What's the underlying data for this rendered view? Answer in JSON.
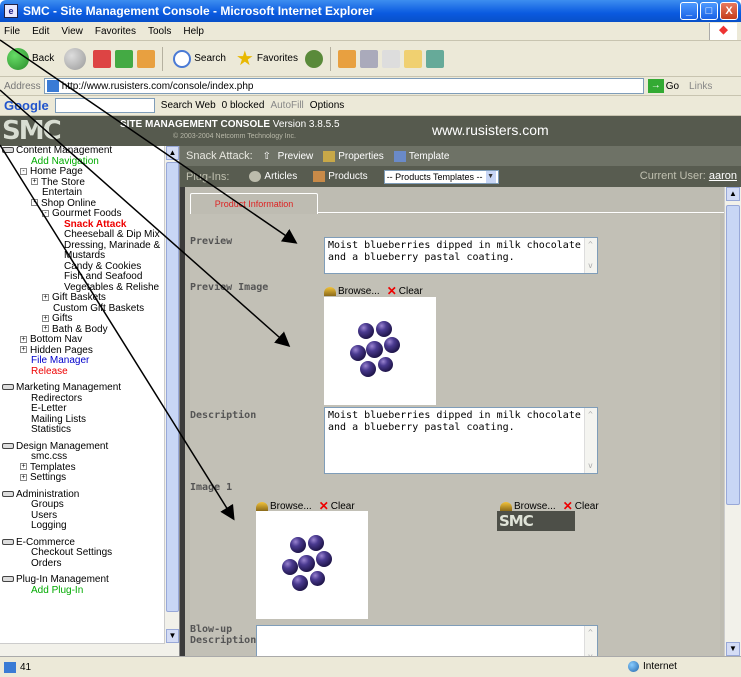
{
  "window": {
    "title": "SMC - Site Management Console - Microsoft Internet Explorer",
    "buttons": [
      "_",
      "□",
      "X"
    ]
  },
  "menu": [
    "File",
    "Edit",
    "View",
    "Favorites",
    "Tools",
    "Help"
  ],
  "toolbar": {
    "back": "Back",
    "search": "Search",
    "favorites": "Favorites"
  },
  "address": {
    "label": "Address",
    "url": "http://www.rusisters.com/console/index.php",
    "go": "Go",
    "links": "Links"
  },
  "google": {
    "logo": "Google",
    "search_web": "Search Web",
    "blocked": "0 blocked",
    "autofill": "AutoFill",
    "options": "Options"
  },
  "smc": {
    "logo": "SMC",
    "title": "SITE MANAGEMENT CONSOLE",
    "version": "Version 3.8.5.5",
    "copyright": "© 2003-2004 Netcomm Technology Inc.",
    "domain": "www.rusisters.com"
  },
  "sidebar": {
    "items": [
      {
        "text": "Content Management",
        "kind": "group"
      },
      {
        "text": "Add Navigation",
        "kind": "green",
        "indent": 1
      },
      {
        "text": "Home Page",
        "kind": "node",
        "indent": 0,
        "exp": "-"
      },
      {
        "text": "The Store",
        "kind": "node",
        "indent": 1,
        "exp": "+"
      },
      {
        "text": "Entertain",
        "kind": "leaf",
        "indent": 2
      },
      {
        "text": "Shop Online",
        "kind": "node",
        "indent": 1,
        "exp": "-"
      },
      {
        "text": "Gourmet Foods",
        "kind": "node",
        "indent": 2,
        "exp": "-"
      },
      {
        "text": "Snack Attack",
        "kind": "active",
        "indent": 4
      },
      {
        "text": "Cheeseball & Dip Mix",
        "kind": "leaf",
        "indent": 4
      },
      {
        "text": "Dressing, Marinade &",
        "kind": "leaf",
        "indent": 4
      },
      {
        "text": "Mustards",
        "kind": "leaf",
        "indent": 4
      },
      {
        "text": "Candy & Cookies",
        "kind": "leaf",
        "indent": 4
      },
      {
        "text": "Fish and Seafood",
        "kind": "leaf",
        "indent": 4
      },
      {
        "text": "Vegetables & Relishe",
        "kind": "leaf",
        "indent": 4
      },
      {
        "text": "Gift Baskets",
        "kind": "node",
        "indent": 2,
        "exp": "+"
      },
      {
        "text": "Custom Gift Baskets",
        "kind": "leaf",
        "indent": 3
      },
      {
        "text": "Gifts",
        "kind": "node",
        "indent": 2,
        "exp": "+"
      },
      {
        "text": "Bath & Body",
        "kind": "node",
        "indent": 2,
        "exp": "+"
      },
      {
        "text": "Bottom Nav",
        "kind": "node",
        "indent": 0,
        "exp": "+"
      },
      {
        "text": "Hidden Pages",
        "kind": "node",
        "indent": 0,
        "exp": "+"
      },
      {
        "text": "File Manager",
        "kind": "blue",
        "indent": 1
      },
      {
        "text": "Release",
        "kind": "red",
        "indent": 1
      },
      {
        "text": "",
        "kind": "gap"
      },
      {
        "text": "Marketing Management",
        "kind": "group"
      },
      {
        "text": "Redirectors",
        "kind": "leaf",
        "indent": 1
      },
      {
        "text": "E-Letter",
        "kind": "leaf",
        "indent": 1
      },
      {
        "text": "Mailing Lists",
        "kind": "leaf",
        "indent": 1
      },
      {
        "text": "Statistics",
        "kind": "leaf",
        "indent": 1
      },
      {
        "text": "",
        "kind": "gap"
      },
      {
        "text": "Design Management",
        "kind": "group"
      },
      {
        "text": "smc.css",
        "kind": "leaf",
        "indent": 1
      },
      {
        "text": "Templates",
        "kind": "node",
        "indent": 0,
        "exp": "+"
      },
      {
        "text": "Settings",
        "kind": "node",
        "indent": 0,
        "exp": "+"
      },
      {
        "text": "",
        "kind": "gap"
      },
      {
        "text": "Administration",
        "kind": "group"
      },
      {
        "text": "Groups",
        "kind": "leaf",
        "indent": 1
      },
      {
        "text": "Users",
        "kind": "leaf",
        "indent": 1
      },
      {
        "text": "Logging",
        "kind": "leaf",
        "indent": 1
      },
      {
        "text": "",
        "kind": "gap"
      },
      {
        "text": "E-Commerce",
        "kind": "group"
      },
      {
        "text": "Checkout Settings",
        "kind": "leaf",
        "indent": 1
      },
      {
        "text": "Orders",
        "kind": "leaf",
        "indent": 1
      },
      {
        "text": "",
        "kind": "gap"
      },
      {
        "text": "Plug-In Management",
        "kind": "group"
      },
      {
        "text": "Add Plug-In",
        "kind": "green",
        "indent": 1
      }
    ]
  },
  "snackbar": {
    "crumb": "Snack Attack:",
    "preview": "Preview",
    "properties": "Properties",
    "template": "Template"
  },
  "plugbar": {
    "label": "Plug-Ins:",
    "articles": "Articles",
    "products": "Products",
    "select": "-- Products Templates --",
    "current_user_label": "Current User:",
    "current_user": "aaron"
  },
  "form": {
    "tab": "Product Information",
    "preview_label": "Preview",
    "preview_text": "Moist blueberries dipped in milk chocolate and a blueberry pastal coating.",
    "preview_image_label": "Preview Image",
    "browse": "Browse...",
    "clear": "Clear",
    "description_label": "Description",
    "description_text": "Moist blueberries dipped in milk chocolate and a blueberry pastal coating.",
    "image1_label": "Image 1",
    "blowup_label": "Blow-up Description",
    "mini_logo": "SMC"
  },
  "status": {
    "left": "41",
    "zone": "Internet"
  },
  "colors": {
    "title_blue": "#0a5ae0",
    "smc_header": "#565a4e",
    "content_bg": "#bebcb2",
    "active_red": "#e00"
  }
}
